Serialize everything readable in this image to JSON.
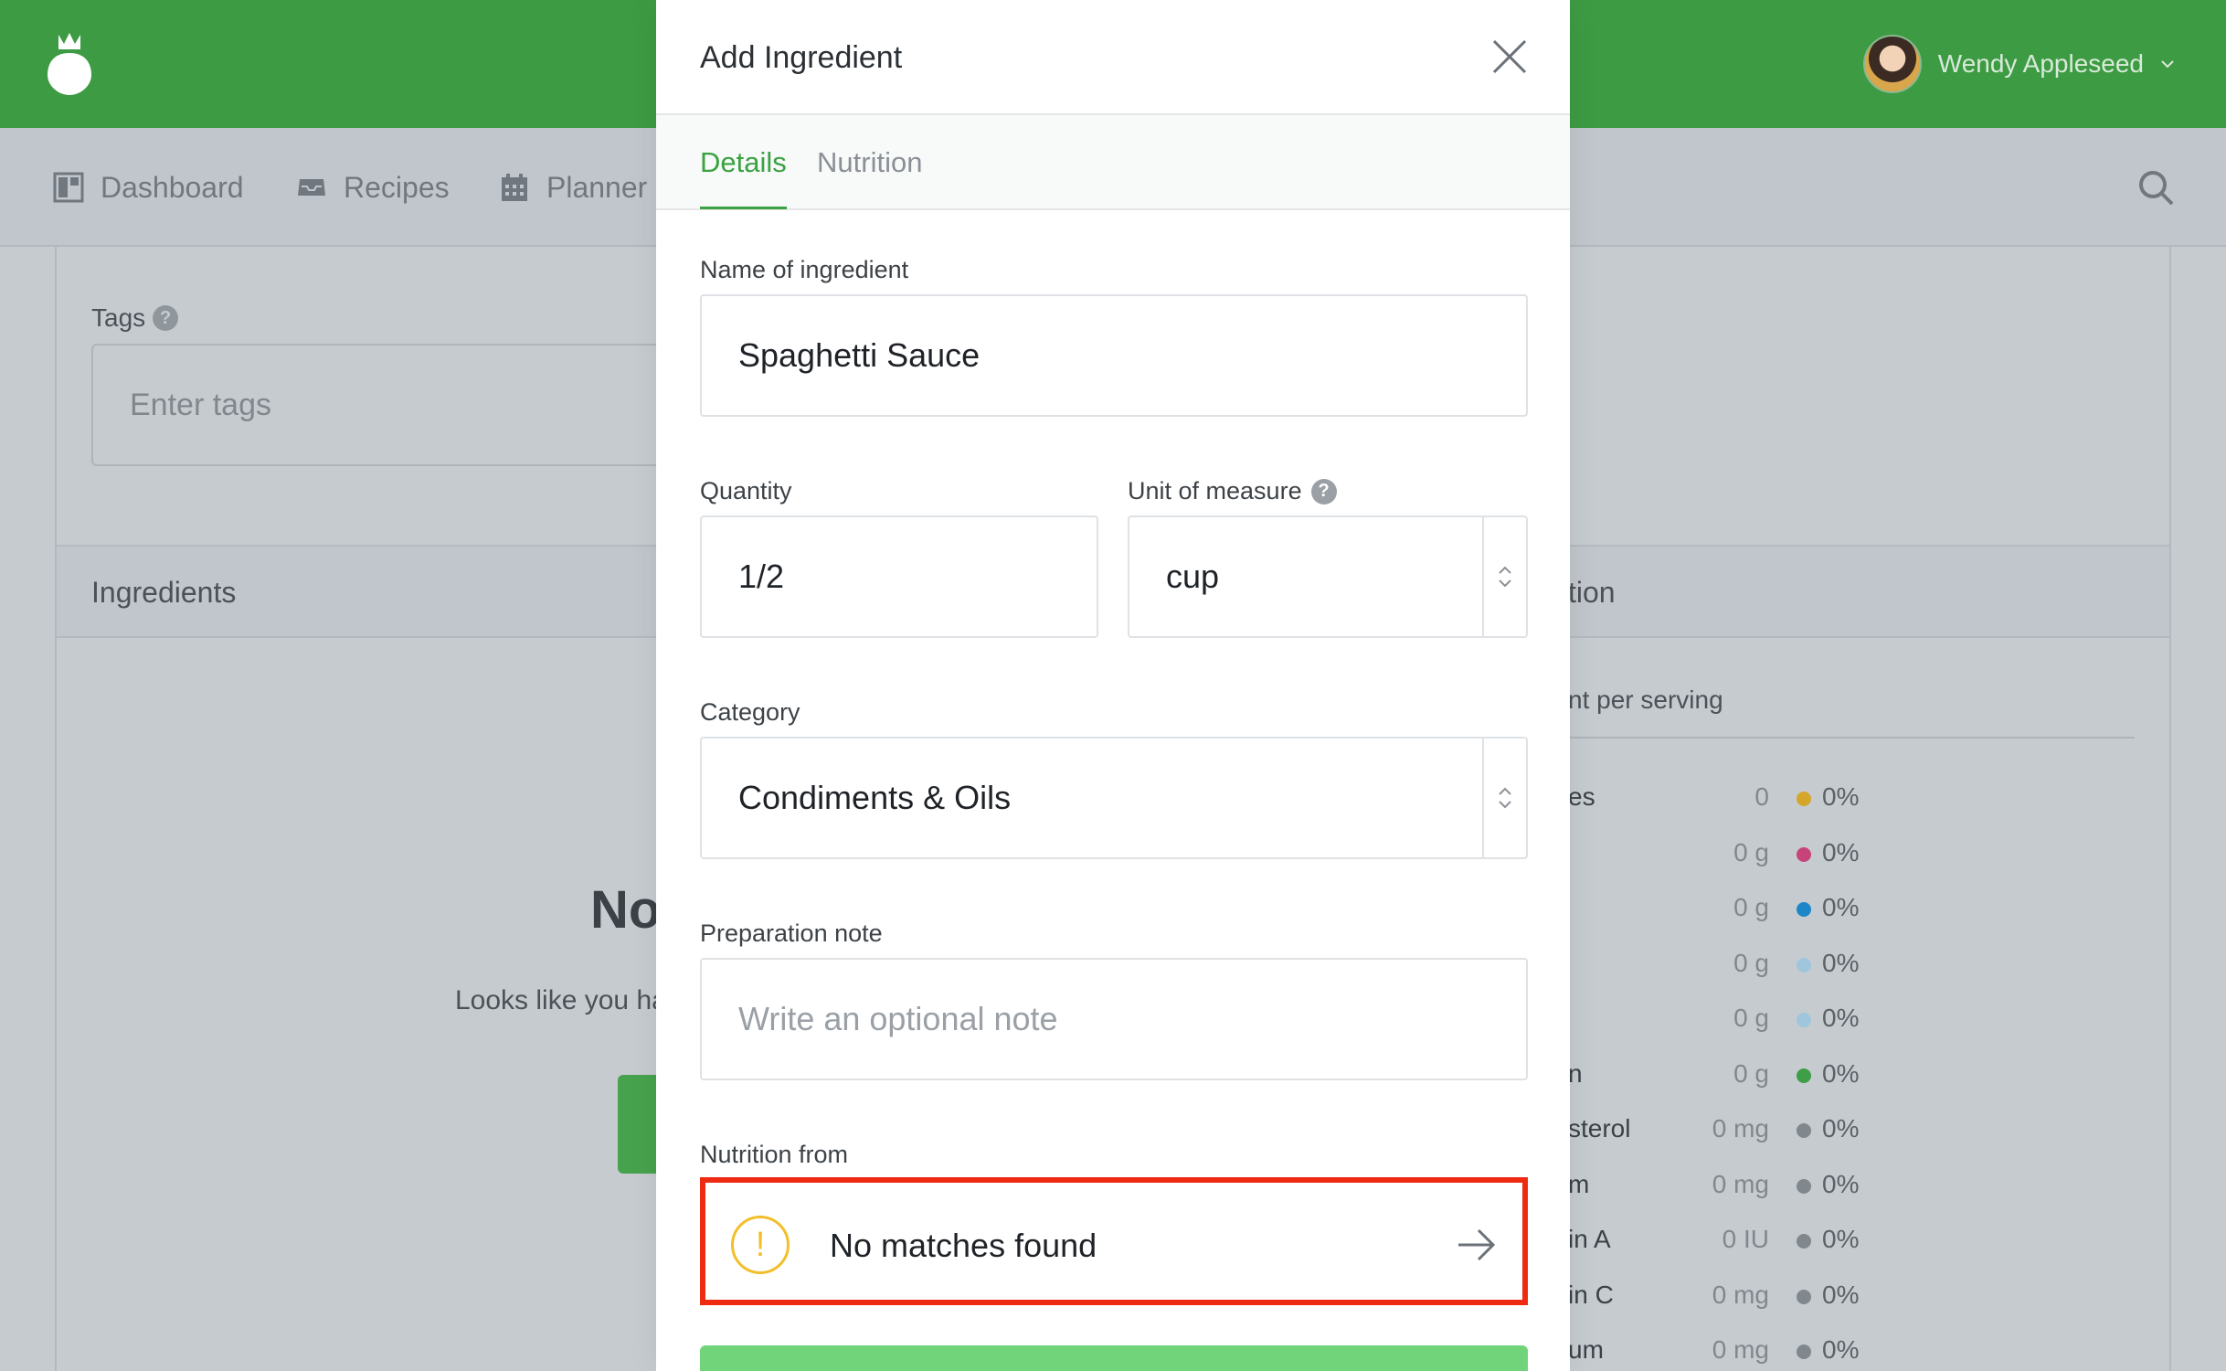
{
  "app": {
    "user_name": "Wendy Appleseed",
    "nav": [
      {
        "label": "Dashboard",
        "icon": "dashboard-icon"
      },
      {
        "label": "Recipes",
        "icon": "inbox-tray-icon"
      },
      {
        "label": "Planner",
        "icon": "calendar-icon"
      }
    ]
  },
  "background": {
    "tags_label": "Tags",
    "tags_placeholder": "Enter tags",
    "ingredients_title": "Ingredients",
    "nutrition_title_partial": "tion",
    "empty_title_partial": "No",
    "empty_text_partial": "Looks like you ha",
    "per_serving_partial": "nt per serving",
    "nutrition_rows": [
      {
        "name": "es",
        "value": "0",
        "pct": "0%",
        "color": "#d4a62a"
      },
      {
        "name": "",
        "value": "0 g",
        "pct": "0%",
        "color": "#c7447a"
      },
      {
        "name": "",
        "value": "0 g",
        "pct": "0%",
        "color": "#1d86c9"
      },
      {
        "name": "",
        "value": "0 g",
        "pct": "0%",
        "color": "#9fc6dc"
      },
      {
        "name": "",
        "value": "0 g",
        "pct": "0%",
        "color": "#9fc6dc"
      },
      {
        "name": "n",
        "value": "0 g",
        "pct": "0%",
        "color": "#3e9f46"
      },
      {
        "name": "sterol",
        "value": "0 mg",
        "pct": "0%",
        "color": "#80878d"
      },
      {
        "name": "m",
        "value": "0 mg",
        "pct": "0%",
        "color": "#80878d"
      },
      {
        "name": "in A",
        "value": "0 IU",
        "pct": "0%",
        "color": "#80878d"
      },
      {
        "name": "in C",
        "value": "0 mg",
        "pct": "0%",
        "color": "#80878d"
      },
      {
        "name": "um",
        "value": "0 mg",
        "pct": "0%",
        "color": "#80878d"
      }
    ]
  },
  "modal": {
    "title": "Add Ingredient",
    "tabs": [
      {
        "label": "Details",
        "active": true
      },
      {
        "label": "Nutrition",
        "active": false
      }
    ],
    "name_label": "Name of ingredient",
    "name_value": "Spaghetti Sauce",
    "quantity_label": "Quantity",
    "quantity_value": "1/2",
    "unit_label": "Unit of measure",
    "unit_value": "cup",
    "category_label": "Category",
    "category_value": "Condiments & Oils",
    "prep_label": "Preparation note",
    "prep_placeholder": "Write an optional note",
    "nutrition_from_label": "Nutrition from",
    "nutrition_from_value": "No matches found",
    "colors": {
      "accent": "#3aa241",
      "highlight": "#ee2a12",
      "warning": "#f2bf2a",
      "brand_bar": "#3d9b43"
    }
  }
}
